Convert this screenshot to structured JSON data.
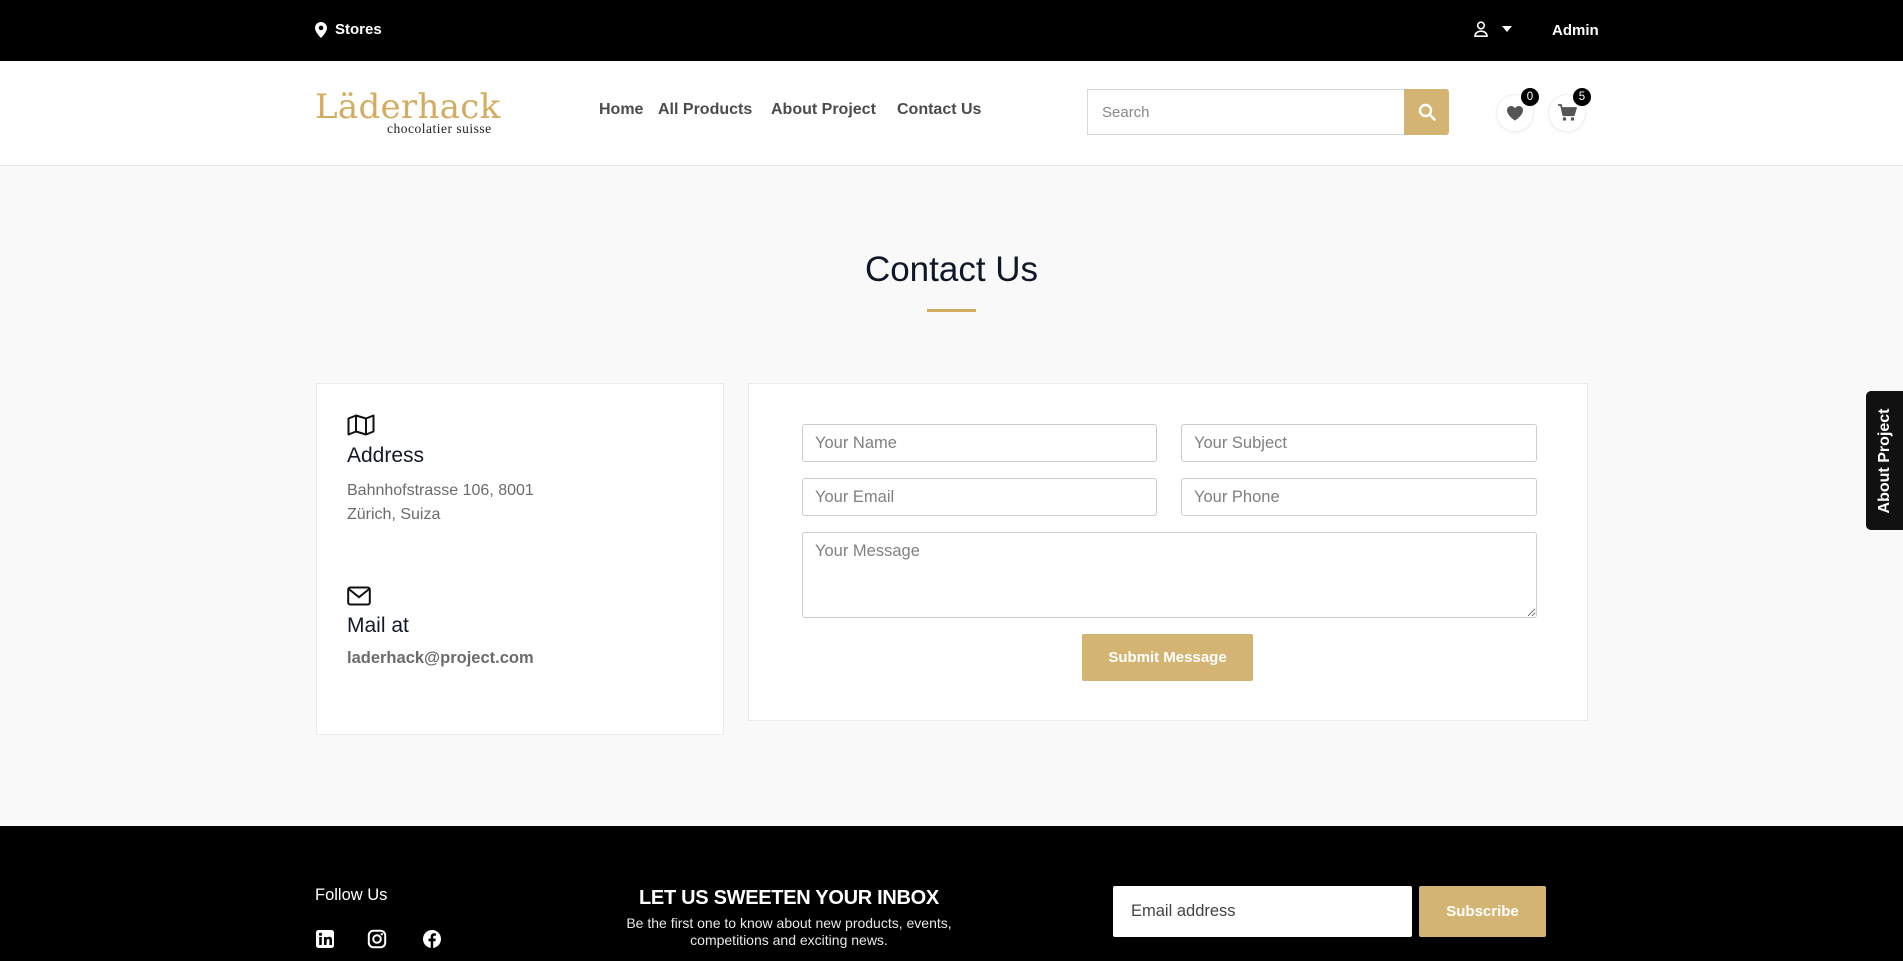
{
  "topbar": {
    "stores_label": "Stores",
    "admin_label": "Admin"
  },
  "header": {
    "logo": {
      "brand": "Läderhack",
      "tagline": "chocolatier suisse"
    },
    "nav": [
      "Home",
      "All Products",
      "About Project",
      "Contact Us"
    ],
    "search_placeholder": "Search",
    "wishlist_count": "0",
    "cart_count": "5"
  },
  "main": {
    "title": "Contact Us",
    "address": {
      "heading": "Address",
      "line1": "Bahnhofstrasse 106, 8001",
      "line2": "Zürich, Suiza"
    },
    "mail": {
      "heading": "Mail at",
      "email": "laderhack@project.com"
    },
    "form": {
      "name_placeholder": "Your Name",
      "subject_placeholder": "Your Subject",
      "email_placeholder": "Your Email",
      "phone_placeholder": "Your Phone",
      "message_placeholder": "Your Message",
      "submit_label": "Submit Message"
    },
    "side_tab_label": "About Project"
  },
  "footer": {
    "follow_label": "Follow Us",
    "social": [
      "linkedin-icon",
      "instagram-icon",
      "facebook-icon"
    ],
    "newsletter_title": "LET US SWEETEN YOUR INBOX",
    "newsletter_desc_line1": "Be the first one to know about new products, events,",
    "newsletter_desc_line2": "competitions and exciting news.",
    "email_placeholder": "Email address",
    "subscribe_label": "Subscribe"
  },
  "colors": {
    "accent": "#d3b473",
    "logo": "#d3ac5f",
    "dark": "#000000",
    "background": "#f9f9f9"
  }
}
